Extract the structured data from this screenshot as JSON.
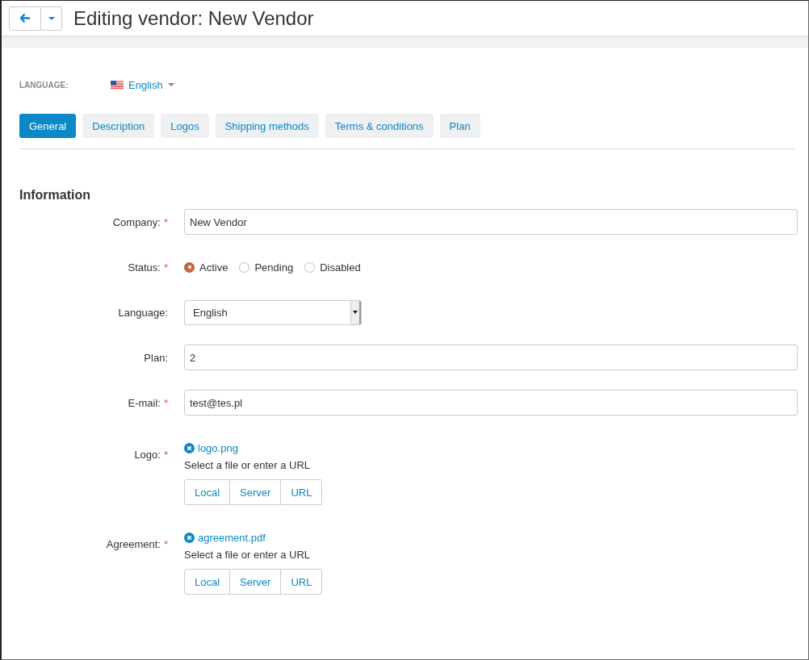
{
  "header": {
    "title": "Editing vendor: New Vendor"
  },
  "language_selector": {
    "label": "LANGUAGE:",
    "value": "English"
  },
  "tabs": [
    {
      "label": "General",
      "selected": true
    },
    {
      "label": "Description",
      "selected": false
    },
    {
      "label": "Logos",
      "selected": false
    },
    {
      "label": "Shipping methods",
      "selected": false
    },
    {
      "label": "Terms & conditions",
      "selected": false
    },
    {
      "label": "Plan",
      "selected": false
    }
  ],
  "section_title": "Information",
  "fields": [
    {
      "kind": "text",
      "label": "Company:",
      "required_mark": "*",
      "value": "New Vendor"
    },
    {
      "kind": "radio",
      "label": "Status:",
      "required_mark": "*",
      "options": [
        {
          "label": "Active",
          "selected": true
        },
        {
          "label": "Pending",
          "selected": false
        },
        {
          "label": "Disabled",
          "selected": false
        }
      ]
    },
    {
      "kind": "select",
      "label": "Language:",
      "value": "English"
    },
    {
      "kind": "text",
      "label": "Plan:",
      "value": "2"
    },
    {
      "kind": "text",
      "label": "E-mail:",
      "required_mark": "*",
      "value": "test@tes.pl"
    },
    {
      "kind": "file",
      "label": "Logo:",
      "required_mark": "*",
      "file": "logo.png",
      "hint": "Select a file or enter a URL",
      "buttons": [
        "Local",
        "Server",
        "URL"
      ]
    },
    {
      "kind": "file",
      "label": "Agreement:",
      "required_mark": "*",
      "file": "agreement.pdf",
      "hint": "Select a file or enter a URL",
      "buttons": [
        "Local",
        "Server",
        "URL"
      ]
    }
  ]
}
